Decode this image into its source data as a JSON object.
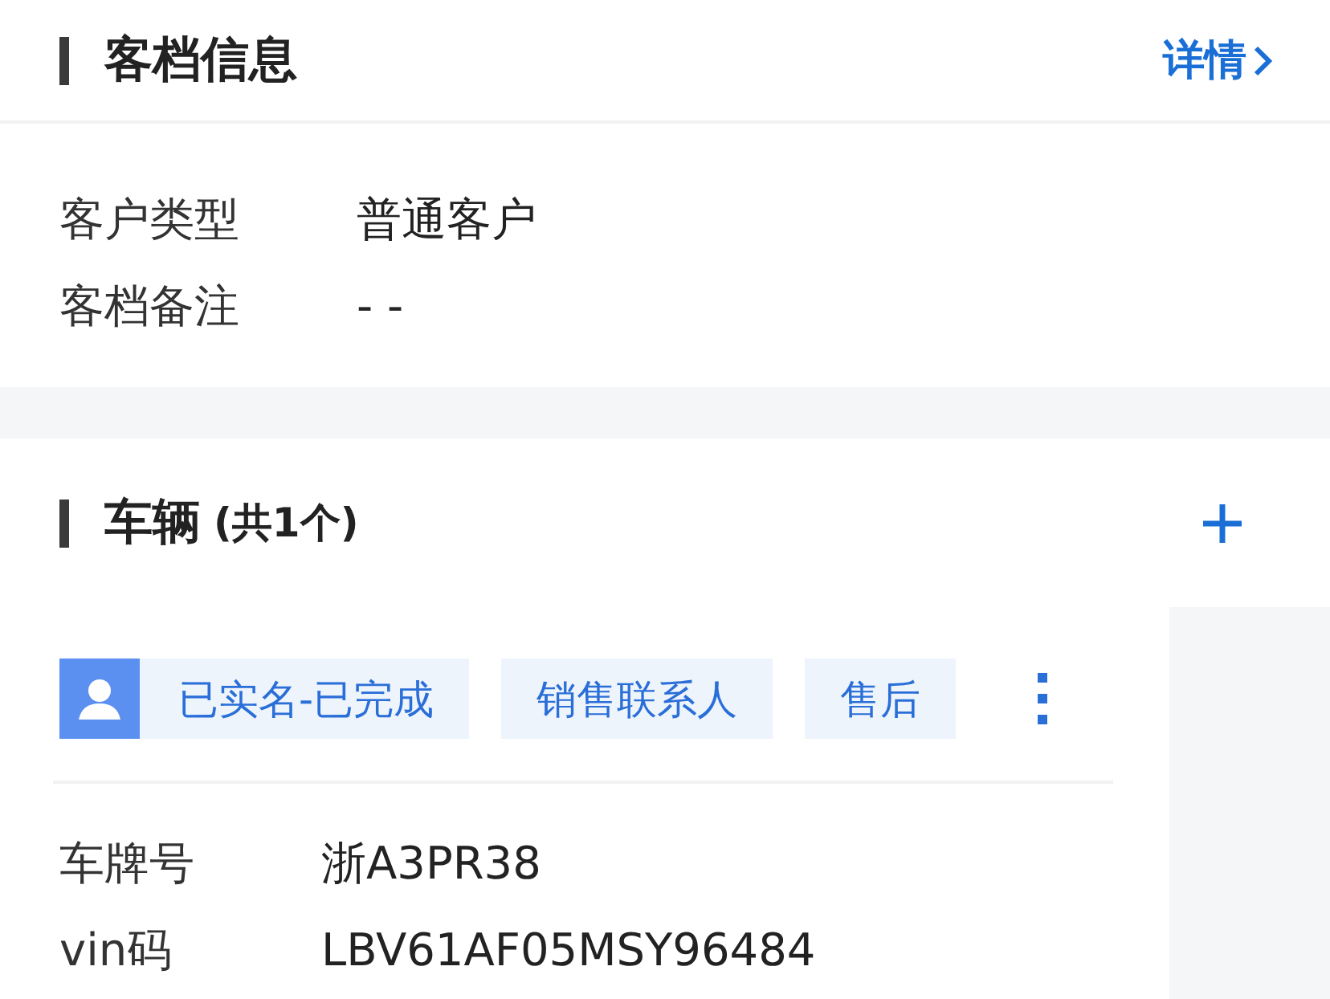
{
  "archive_section": {
    "title": "客档信息",
    "link": "详情"
  },
  "archive_fields": [
    {
      "label": "客户类型",
      "value": "普通客户"
    },
    {
      "label": "客档备注",
      "value": "- -"
    }
  ],
  "vehicle_section": {
    "title": "车辆",
    "count": "(共1个)"
  },
  "vehicle_card": {
    "tags": [
      {
        "label": "已实名-已完成",
        "kind": "verified"
      },
      {
        "label": "销售联系人",
        "kind": "plain"
      },
      {
        "label": "售后",
        "kind": "plain"
      }
    ],
    "fields": [
      {
        "label": "车牌号",
        "value": "浙A3PR38"
      },
      {
        "label": "vin码",
        "value": "LBV61AF05MSY96484"
      }
    ]
  }
}
